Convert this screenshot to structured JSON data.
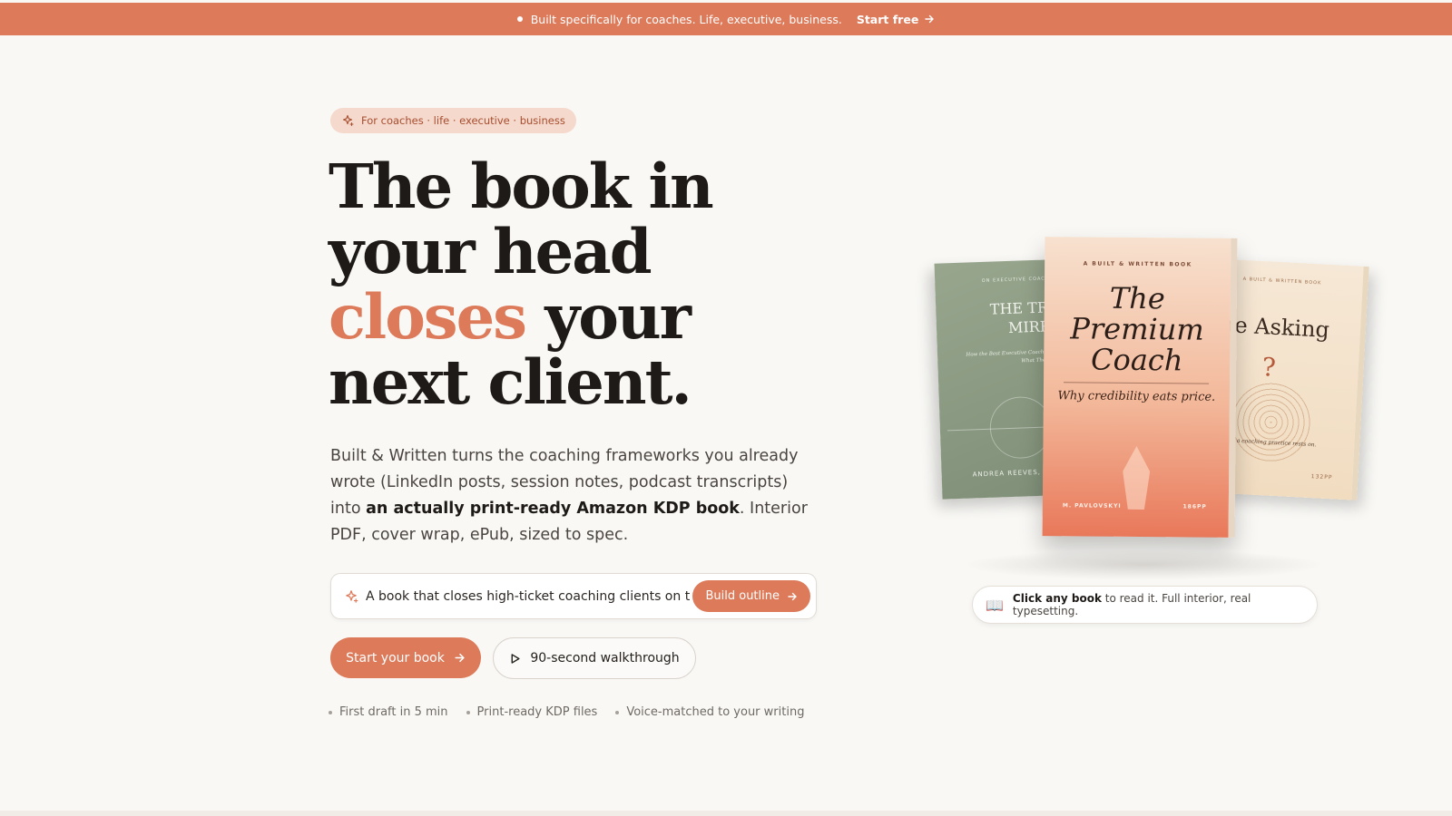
{
  "announcement": {
    "message": "Built specifically for coaches. Life, executive, business.",
    "cta": "Start free"
  },
  "hero": {
    "pill": "For coaches · life · executive · business",
    "headline": {
      "line1": "The book in",
      "line2": "your head",
      "accent": "closes",
      "line3_rest": " your",
      "line4": "next client."
    },
    "sub": {
      "part1": "Built & Written turns the coaching frameworks you already wrote (LinkedIn posts, session notes, podcast transcripts) into ",
      "bold": "an actually print-ready Amazon KDP book",
      "part2": ". Interior PDF, cover wrap, ePub, sized to spec."
    },
    "prompt": {
      "value": "A book that closes high-ticket coaching clients on th",
      "button": "Build outline"
    },
    "primary_cta": "Start your book",
    "secondary_cta": "90-second walkthrough",
    "features": [
      "First draft in 5 min",
      "Print-ready KDP files",
      "Voice-matched to your writing"
    ]
  },
  "books": {
    "left": {
      "label": "ON EXECUTIVE COACHING",
      "title_line1": "THE TRUSTE",
      "title_line2": "MIRROR",
      "tagline": "How the Best Executive Coaches H C-Suite Leaders See What They C",
      "author": "ANDREA REEVES, F"
    },
    "center": {
      "label": "A BUILT & WRITTEN BOOK",
      "title_line1": "The",
      "title_line2": "Premium",
      "title_line3": "Coach",
      "tagline": "Why credibility eats price.",
      "author": "M. PAVLOVSKYI",
      "pages": "186PP"
    },
    "right": {
      "label": "A BUILT & WRITTEN BOOK",
      "title": "he Asking",
      "mark": "?",
      "tagline": "ions a coaching practice rests on.",
      "pages": "132PP"
    }
  },
  "hint": {
    "icon": "📖",
    "bold": "Click any book",
    "rest": " to read it. Full interior, real typesetting."
  },
  "colors": {
    "accent": "#dc7a5a",
    "background": "#f9f8f5",
    "pill_bg": "#f4d9cc"
  }
}
